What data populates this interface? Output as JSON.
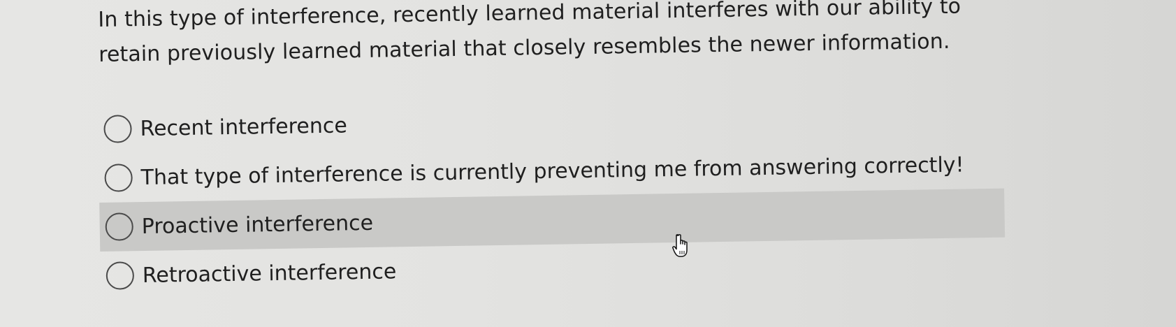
{
  "question": {
    "text": "In this type of interference, recently learned material interferes with our ability to retain previously learned material that closely resembles the newer information."
  },
  "options": [
    {
      "label": "Recent interference",
      "selected": false,
      "hovered": false
    },
    {
      "label": "That type of interference is currently preventing me from answering correctly!",
      "selected": false,
      "hovered": false
    },
    {
      "label": "Proactive interference",
      "selected": false,
      "hovered": true
    },
    {
      "label": "Retroactive interference",
      "selected": false,
      "hovered": false
    }
  ],
  "colors": {
    "background": "#e2e2e0",
    "hover_row": "#c9c9c7",
    "text": "#1f1f1f",
    "radio_border": "#4a4a4a"
  },
  "cursor": {
    "icon": "hand-pointer-icon"
  }
}
